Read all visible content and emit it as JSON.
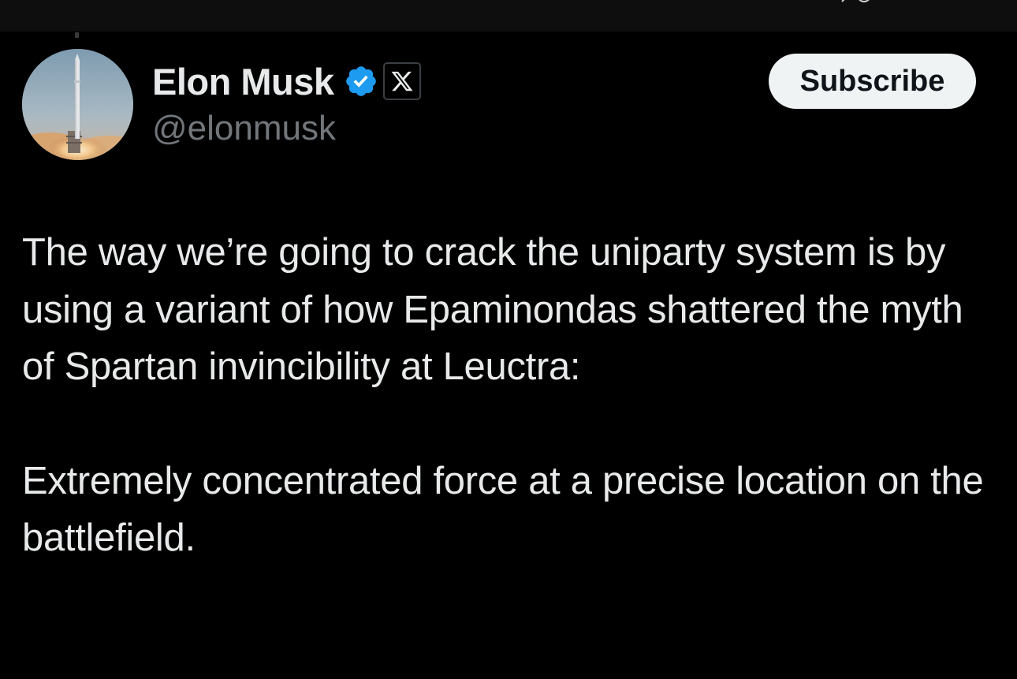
{
  "author": {
    "display_name": "Elon Musk",
    "handle": "@elonmusk",
    "verified_badge_icon": "verified-check-icon",
    "affiliate_badge_icon": "x-logo-icon",
    "avatar_icon": "rocket-launch-avatar"
  },
  "actions": {
    "subscribe_label": "Subscribe"
  },
  "tweet": {
    "paragraph_1": "The way we’re going to crack the uniparty system is by using a variant of how Epaminondas shattered the myth of Spartan invincibility at Leuctra:",
    "paragraph_2": "Extremely concentrated force at a precise location on the battlefield."
  },
  "colors": {
    "background": "#000000",
    "primary_text": "#e7e9ea",
    "secondary_text": "#71767b",
    "verified_blue": "#1d9bf0",
    "subscribe_bg": "#eff3f4"
  }
}
